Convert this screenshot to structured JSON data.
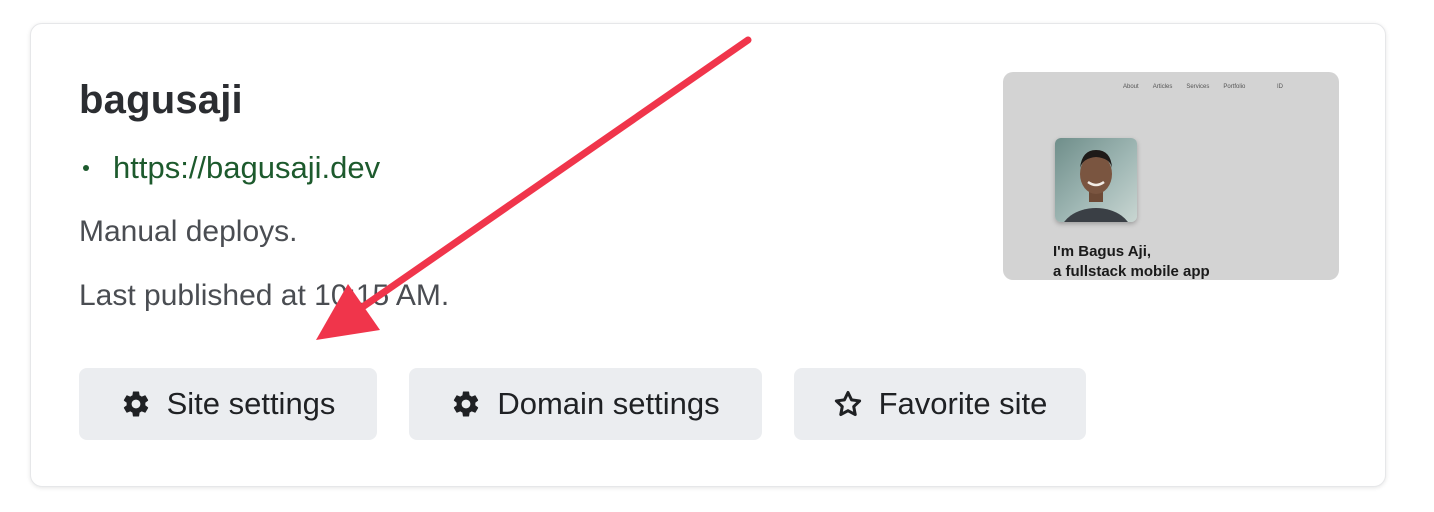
{
  "site": {
    "name": "bagusaji",
    "url": "https://bagusaji.dev",
    "deploy_mode": "Manual deploys.",
    "last_published": "Last published at 10:15 AM."
  },
  "actions": {
    "site_settings": {
      "label": "Site settings",
      "icon": "gear-icon"
    },
    "domain_settings": {
      "label": "Domain settings",
      "icon": "gear-icon"
    },
    "favorite_site": {
      "label": "Favorite site",
      "icon": "star-outline-icon"
    }
  },
  "preview": {
    "nav_items": [
      "About",
      "Articles",
      "Services",
      "Portfolio"
    ],
    "lang": "ID",
    "hero_line1": "I'm Bagus Aji,",
    "hero_line2": "a fullstack mobile app"
  },
  "colors": {
    "link": "#1d5a2d",
    "button_bg": "#ebedf0",
    "annotation_arrow": "#f0354b",
    "preview_bg": "#d3d3d3"
  }
}
